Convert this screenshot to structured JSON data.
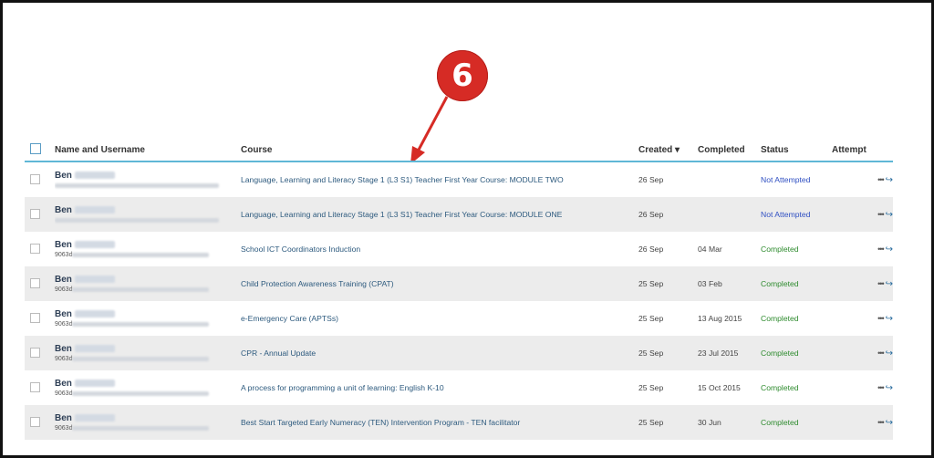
{
  "callout": {
    "number": "6"
  },
  "table": {
    "headers": {
      "name": "Name and Username",
      "course": "Course",
      "created": "Created ▾",
      "completed": "Completed",
      "status": "Status",
      "attempt": "Attempt"
    },
    "rows": [
      {
        "name": "Ben",
        "uid_prefix": "",
        "course": "Language, Learning and Literacy Stage 1 (L3 S1) Teacher First Year Course: MODULE TWO",
        "created": "26 Sep",
        "completed": "",
        "status": "Not Attempted"
      },
      {
        "name": "Ben",
        "uid_prefix": "",
        "course": "Language, Learning and Literacy Stage 1 (L3 S1) Teacher First Year Course: MODULE ONE",
        "created": "26 Sep",
        "completed": "",
        "status": "Not Attempted"
      },
      {
        "name": "Ben",
        "uid_prefix": "9063d",
        "course": "School ICT Coordinators Induction",
        "created": "26 Sep",
        "completed": "04 Mar",
        "status": "Completed"
      },
      {
        "name": "Ben",
        "uid_prefix": "9063d",
        "course": "Child Protection Awareness Training (CPAT)",
        "created": "25 Sep",
        "completed": "03 Feb",
        "status": "Completed"
      },
      {
        "name": "Ben",
        "uid_prefix": "9063d",
        "course": "e-Emergency Care (APTSs)",
        "created": "25 Sep",
        "completed": "13 Aug 2015",
        "status": "Completed"
      },
      {
        "name": "Ben",
        "uid_prefix": "9063d",
        "course": "CPR - Annual Update",
        "created": "25 Sep",
        "completed": "23 Jul 2015",
        "status": "Completed"
      },
      {
        "name": "Ben",
        "uid_prefix": "9063d",
        "course": "A process for programming a unit of learning: English K-10",
        "created": "25 Sep",
        "completed": "15 Oct 2015",
        "status": "Completed"
      },
      {
        "name": "Ben",
        "uid_prefix": "9063d",
        "course": "Best Start Targeted Early Numeracy (TEN) Intervention Program - TEN facilitator",
        "created": "25 Sep",
        "completed": "30 Jun",
        "status": "Completed"
      }
    ],
    "row_actions": {
      "more_glyph": "•••",
      "open_glyph": "↪"
    }
  },
  "colors": {
    "callout": "#d62b25",
    "header_rule": "#5fb7d6",
    "status_not_attempted": "#2f4fc2",
    "status_completed": "#2e8b2e"
  }
}
